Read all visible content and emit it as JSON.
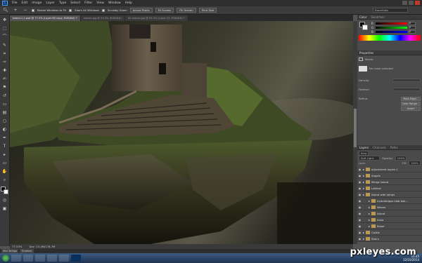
{
  "menubar": {
    "logo": "Ps",
    "items": [
      "File",
      "Edit",
      "Image",
      "Layer",
      "Type",
      "Select",
      "Filter",
      "View",
      "Window",
      "Help"
    ]
  },
  "options": {
    "resize_windows": "Resize Windows to Fit",
    "zoom_all": "Zoom All Windows",
    "scrubby_zoom": "Scrubby Zoom",
    "actual_pixels": "Actual Pixels",
    "fit_screen": "Fit Screen",
    "fill_screen": "Fill Screen",
    "print_size": "Print Size",
    "workspace": "Essentials"
  },
  "tabs": [
    {
      "label": "Island-1-1.psd @ 77.5% (Layer 65 copy, RGB/8#) *",
      "active": true
    },
    {
      "label": "stones.jpg @ 33.3% (RGB/8#)",
      "active": false
    },
    {
      "label": "Ier stones.jpg @ 33.3% (Layer 22, RGB/8#) *",
      "active": false
    }
  ],
  "statusbar": {
    "zoom": "77.53%",
    "doc": "Doc: 13.4M/178.7M"
  },
  "minibridge": [
    "Mini Bridge",
    "Timeline"
  ],
  "color_panel": {
    "tabs": [
      "Color",
      "Swatches"
    ],
    "rows": [
      {
        "label": "R",
        "value": "0"
      },
      {
        "label": "G",
        "value": "0"
      },
      {
        "label": "B",
        "value": "0"
      }
    ]
  },
  "properties_panel": {
    "title": "Properties",
    "subtitle": "Masks",
    "no_mask": "No mask selected",
    "density": "Density:",
    "feather": "Feather:",
    "refine": "Refine:",
    "btn_mask_edge": "Mask Edge...",
    "btn_color_range": "Color Range...",
    "btn_invert": "Invert"
  },
  "layers_panel": {
    "tabs": [
      "Layers",
      "Channels",
      "Paths"
    ],
    "kind": "Kind",
    "blend_mode": "Soft Light",
    "opacity_label": "Opacity:",
    "opacity": "100%",
    "lock_label": "Lock:",
    "fill_label": "Fill:",
    "fill": "100%",
    "layers": [
      {
        "name": "adjustment layers 1",
        "type": "folder",
        "indent": 0,
        "selected": false
      },
      {
        "name": "Angels",
        "type": "folder",
        "indent": 0,
        "selected": false
      },
      {
        "name": "Merge island",
        "type": "folder",
        "indent": 0,
        "selected": false
      },
      {
        "name": "Lettera",
        "type": "folder",
        "indent": 0,
        "selected": false
      },
      {
        "name": "Island with lamps",
        "type": "folder",
        "indent": 0,
        "selected": false
      },
      {
        "name": "hydrodolgos slab blai...",
        "type": "folder",
        "indent": 1,
        "selected": false
      },
      {
        "name": "Waves",
        "type": "folder",
        "indent": 1,
        "selected": false
      },
      {
        "name": "Island",
        "type": "folder",
        "indent": 1,
        "selected": false
      },
      {
        "name": "Insta",
        "type": "folder",
        "indent": 1,
        "selected": false
      },
      {
        "name": "Boxer",
        "type": "folder",
        "indent": 1,
        "selected": false
      },
      {
        "name": "Castle",
        "type": "folder",
        "indent": 0,
        "selected": false
      },
      {
        "name": "Stairs",
        "type": "folder",
        "indent": 0,
        "selected": false
      }
    ]
  },
  "taskbar": {
    "time": "10:45",
    "date": "12/10/2014"
  },
  "watermark": "pxleyes.com",
  "colors": {
    "accent": "#3d6ea3",
    "panel_bg": "#535353"
  }
}
